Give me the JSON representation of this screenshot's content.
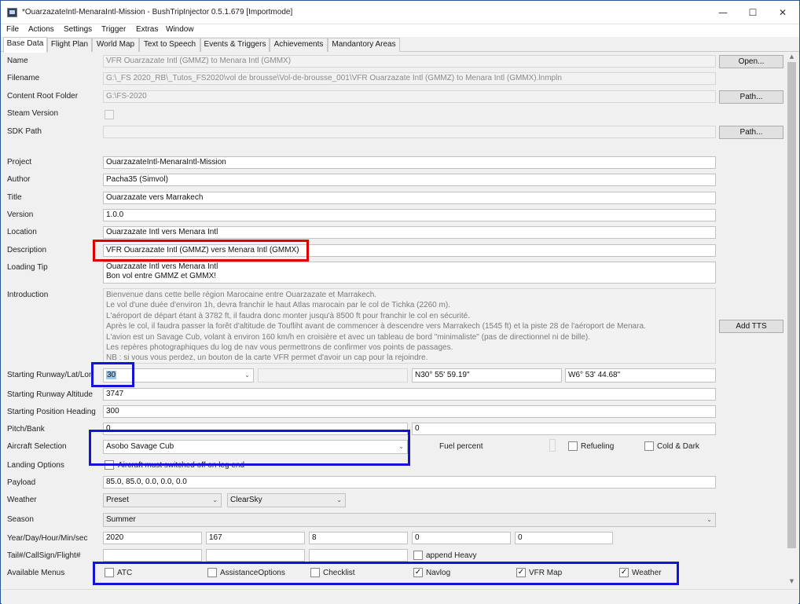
{
  "window": {
    "title": "*OuarzazateIntl-MenaraIntl-Mission - BushTripInjector 0.5.1.679 [Importmode]"
  },
  "menu": [
    "File",
    "Actions",
    "Settings",
    "Trigger",
    "Extras",
    "Window"
  ],
  "tabs": [
    "Base Data",
    "Flight Plan",
    "World Map",
    "Text to Speech",
    "Events & Triggers",
    "Achievements",
    "Mandantory Areas"
  ],
  "active_tab": "Base Data",
  "labels": {
    "name": "Name",
    "filename": "Filename",
    "content_root": "Content Root Folder",
    "steam": "Steam Version",
    "sdk_path": "SDK Path",
    "project": "Project",
    "author": "Author",
    "title": "Title",
    "version": "Version",
    "location": "Location",
    "description": "Description",
    "loading_tip": "Loading Tip",
    "introduction": "Introduction",
    "runway": "Starting Runway/Lat/Lon",
    "runway_alt": "Starting Runway Altitude",
    "heading": "Starting Position Heading",
    "pitch_bank": "Pitch/Bank",
    "aircraft": "Aircraft Selection",
    "landing": "Landing Options",
    "payload": "Payload",
    "weather": "Weather",
    "season": "Season",
    "datetime": "Year/Day/Hour/Min/sec",
    "tail": "Tail#/CallSign/Flight#",
    "menus": "Available Menus"
  },
  "values": {
    "name": "VFR Ouarzazate Intl (GMMZ) to Menara Intl (GMMX)",
    "filename": "G:\\_FS 2020_RB\\_Tutos_FS2020\\vol de brousse\\Vol-de-brousse_001\\VFR Ouarzazate Intl (GMMZ) to Menara Intl (GMMX).lnmpln",
    "content_root": "G:\\FS-2020",
    "sdk_path": "",
    "project": "OuarzazateIntl-MenaraIntl-Mission",
    "author": "Pacha35 (Simvol)",
    "title": "Ouarzazate vers Marrakech",
    "version": "1.0.0",
    "location": "Ouarzazate Intl vers Menara Intl",
    "description": "VFR Ouarzazate Intl (GMMZ) vers Menara Intl (GMMX)",
    "loading_tip_1": "Ouarzazate Intl vers Menara Intl",
    "loading_tip_2": "Bon vol entre GMMZ et GMMX!",
    "intro_lines": [
      "Bienvenue dans cette belle région Marocaine entre Ouarzazate et Marrakech.",
      "Le vol d'une duée d'environ 1h, devra franchir le haut Atlas marocain par le col de Tichka (2260 m).",
      "L'aéroport de départ étant à 3782 ft, il faudra donc monter jusqu'à 8500 ft pour franchir le col en sécurité.",
      "Après le col, il faudra passer la forêt d'altitude de Toufliht avant de commencer à descendre vers Marrakech (1545 ft) et la piste 28 de l'aéroport de Menara.",
      "L'avion est un Savage Cub, volant à environ 160 km/h en croisière et avec un tableau de bord \"minimaliste\" (pas de directionnel ni de bille).",
      "Les repères photographiques du log de nav vous permettrons de confirmer vos points de passages.",
      "NB : si vous vous perdez, un bouton de la carte VFR permet d'avoir un cap pour la rejoindre."
    ],
    "runway": "30",
    "lat": "N30° 55' 59.19\"",
    "lon": "W6° 53' 44.68\"",
    "runway_alt": "3747",
    "heading": "300",
    "pitch": "0",
    "bank": "0",
    "aircraft": "Asobo Savage Cub",
    "fuel_label": "Fuel percent",
    "refueling_label": "Refueling",
    "cold_dark_label": "Cold & Dark",
    "landing_option": "Aircraft must switched off on leg end",
    "payload": "85.0,  85.0,   0.0,   0.0,   0.0",
    "weather_mode": "Preset",
    "weather_preset": "ClearSky",
    "season": "Summer",
    "year": "2020",
    "day": "167",
    "hour": "8",
    "min": "0",
    "sec": "0",
    "append_heavy": "append Heavy"
  },
  "buttons": {
    "open": "Open...",
    "path1": "Path...",
    "path2": "Path...",
    "add_tts": "Add TTS"
  },
  "available_menus": [
    {
      "label": "ATC",
      "checked": false
    },
    {
      "label": "AssistanceOptions",
      "checked": false
    },
    {
      "label": "Checklist",
      "checked": false
    },
    {
      "label": "Navlog",
      "checked": true
    },
    {
      "label": "VFR Map",
      "checked": true
    },
    {
      "label": "Weather",
      "checked": true
    }
  ],
  "colors": {
    "highlight_red": "#e00000",
    "highlight_blue": "#1414d8"
  }
}
